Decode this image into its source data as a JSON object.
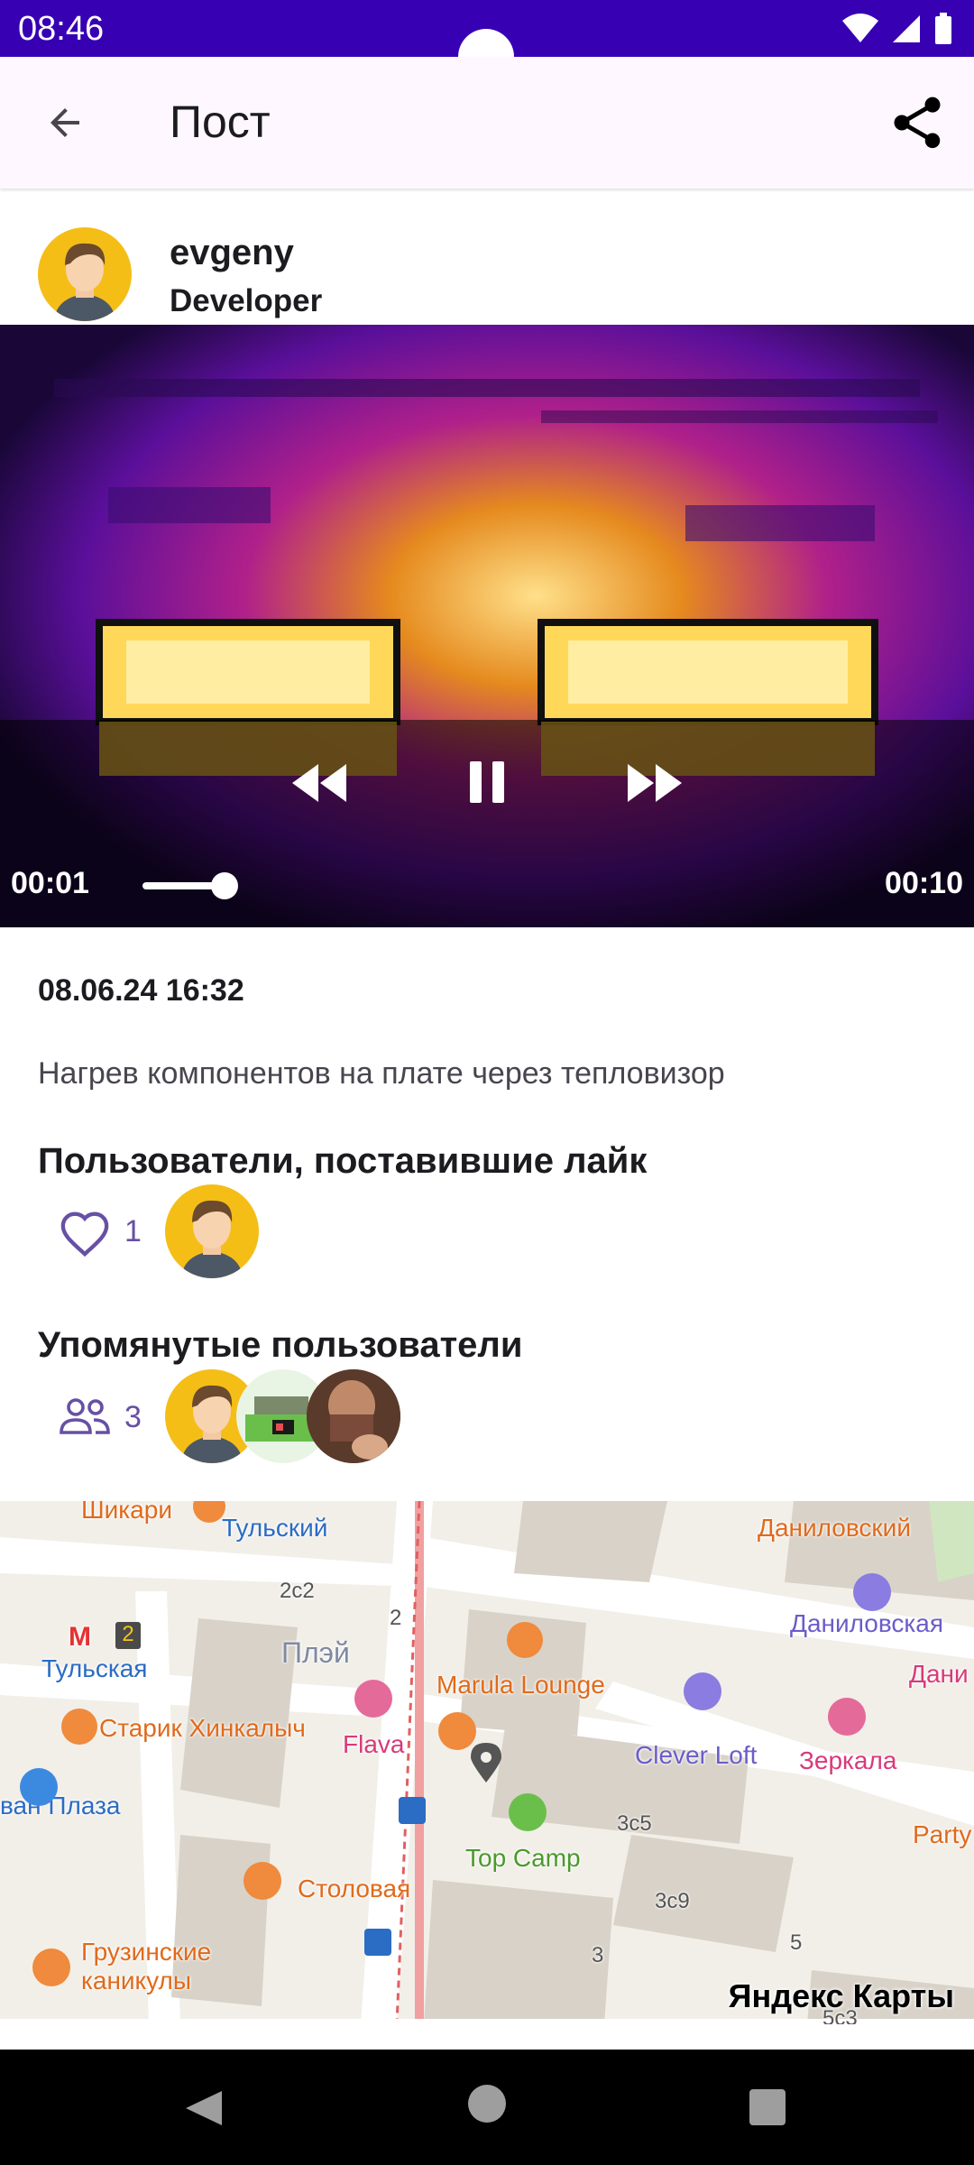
{
  "status_bar": {
    "time": "08:46"
  },
  "app_bar": {
    "title": "Пост"
  },
  "author": {
    "name": "evgeny",
    "job": "Developer"
  },
  "video": {
    "position": "00:01",
    "duration": "00:10",
    "progress_fraction": 0.1
  },
  "post": {
    "published": "08.06.24 16:32",
    "content": "Нагрев компонентов на плате через тепловизор"
  },
  "likers": {
    "heading": "Пользователи, поставившие лайк",
    "count": "1"
  },
  "mentioned": {
    "heading": "Упомянутые пользователи",
    "count": "3"
  },
  "map": {
    "logo": "Яндекс Карты",
    "labels": {
      "shikari": "Шикари",
      "tulsky": "Тульский",
      "danilovsky": "Даниловский",
      "b2c2": "2с2",
      "b2": "2",
      "metro_line": "2",
      "tulskaya": "Тульская",
      "play": "Плэй",
      "marula": "Marula Lounge",
      "danilovskaya": "Даниловская",
      "dani": "Дани",
      "khinkalych": "Старик Хинкалыч",
      "flava": "Flava",
      "clever_loft": "Clever Loft",
      "zerkala": "Зеркала",
      "plaza": "ван Плаза",
      "b3c5": "3с5",
      "party": "Party",
      "top_camp": "Top Camp",
      "stolovaya": "Столовая",
      "b3c9": "3с9",
      "gruzinskie": "Грузинские",
      "kanikuly": "каникулы",
      "b5": "5",
      "b3": "3",
      "b5c3": "5с3"
    }
  },
  "colors": {
    "primary": "#6750a4",
    "status_bar": "#3700b3",
    "app_bar": "#fef7ff",
    "avatar_bg": "#f5be17"
  }
}
